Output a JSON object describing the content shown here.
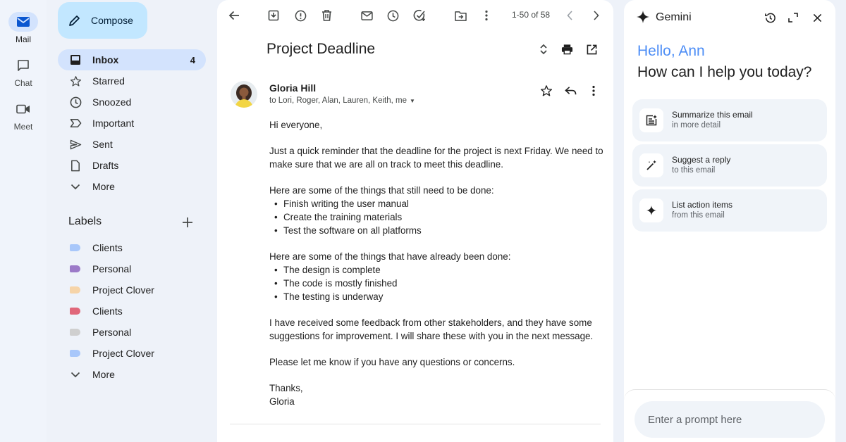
{
  "rail": {
    "mail_label": "Mail",
    "chat_label": "Chat",
    "meet_label": "Meet"
  },
  "nav": {
    "compose_label": "Compose",
    "items": [
      {
        "label": "Inbox",
        "count": "4",
        "icon": "inbox-icon"
      },
      {
        "label": "Starred",
        "icon": "star-icon"
      },
      {
        "label": "Snoozed",
        "icon": "clock-icon"
      },
      {
        "label": "Important",
        "icon": "important-icon"
      },
      {
        "label": "Sent",
        "icon": "send-icon"
      },
      {
        "label": "Drafts",
        "icon": "draft-icon"
      },
      {
        "label": "More",
        "icon": "chevron-down-icon"
      }
    ],
    "labels_heading": "Labels",
    "labels": [
      {
        "label": "Clients",
        "color": "#a8c7fa"
      },
      {
        "label": "Personal",
        "color": "#9c7ac8"
      },
      {
        "label": "Project Clover",
        "color": "#f6d4a8"
      },
      {
        "label": "Clients",
        "color": "#e0677a"
      },
      {
        "label": "Personal",
        "color": "#cfcfcf"
      },
      {
        "label": "Project Clover",
        "color": "#a8c7fa"
      }
    ],
    "labels_more": "More"
  },
  "mail": {
    "pager": "1-50 of 58",
    "subject": "Project Deadline",
    "sender": "Gloria Hill",
    "recipients": "to Lori, Roger, Alan, Lauren, Keith, me",
    "greeting": "Hi everyone,",
    "para1": "Just a quick reminder that the deadline for the project is next Friday. We need to make sure that we are all on track to meet this deadline.",
    "todo_intro": "Here are some of the things that still need to be done:",
    "todo_items": [
      "Finish writing the user manual",
      "Create the training materials",
      "Test the software on all platforms"
    ],
    "done_intro": "Here are some of the things that have already been done:",
    "done_items": [
      "The design is complete",
      "The code is mostly finished",
      "The testing is underway"
    ],
    "para2": "I have received some feedback from other stakeholders, and they have some suggestions for improvement. I will share these with you in the next message.",
    "para3": "Please let me know if you have any questions or concerns.",
    "signoff": "Thanks,",
    "signature": "Gloria"
  },
  "gemini": {
    "title": "Gemini",
    "hello": "Hello, Ann",
    "help": "How can I help you today?",
    "suggestions": [
      {
        "title": "Summarize this email",
        "subtitle": "in more detail",
        "icon": "summarize-icon"
      },
      {
        "title": "Suggest a reply",
        "subtitle": "to this email",
        "icon": "magic-pen-icon"
      },
      {
        "title": "List action items",
        "subtitle": "from this email",
        "icon": "sparkle-icon"
      }
    ],
    "prompt_placeholder": "Enter a prompt here"
  },
  "colors": {
    "accent": "#c2e7ff",
    "active_nav": "#d3e3fd",
    "gemini_blue": "#4c8df6"
  }
}
